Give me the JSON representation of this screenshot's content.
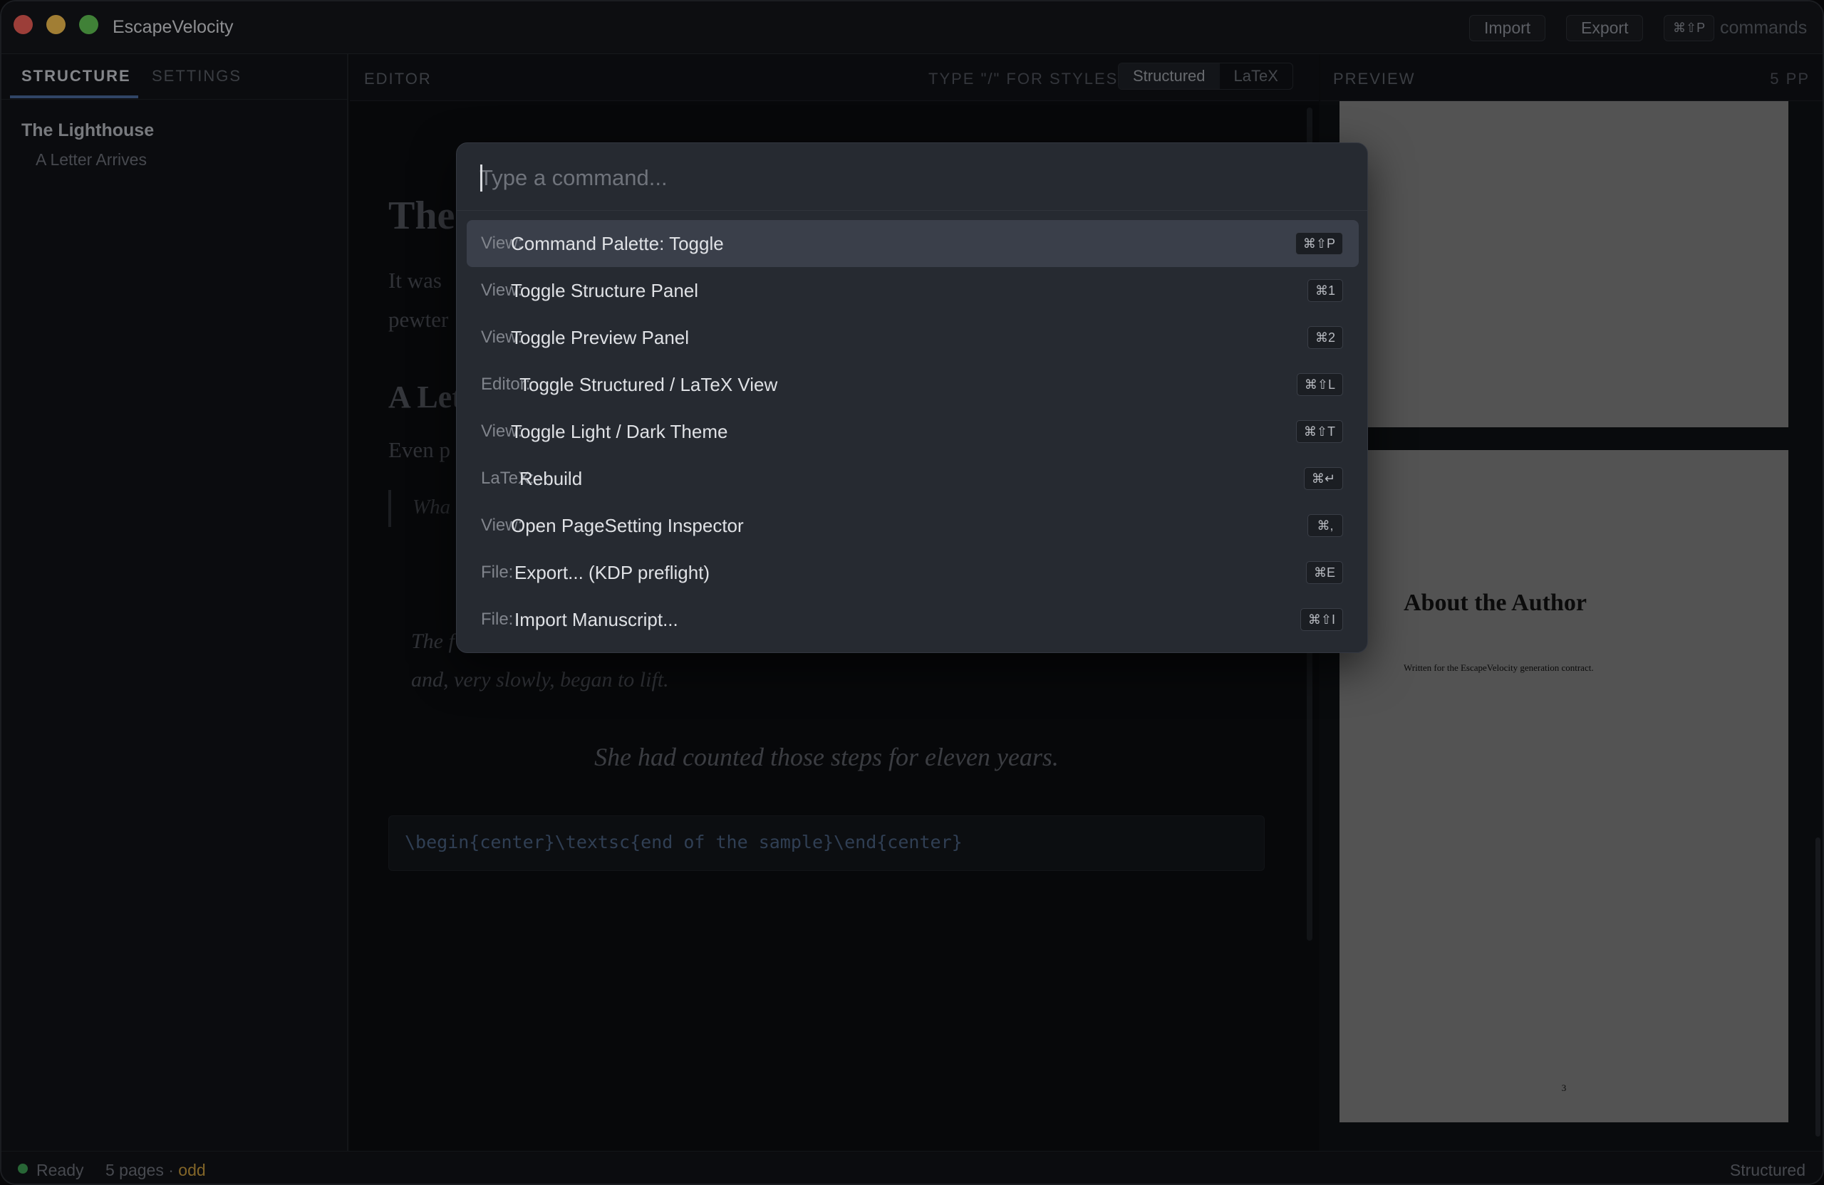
{
  "app": {
    "title": "EscapeVelocity",
    "import_label": "Import",
    "export_label": "Export",
    "palette_shortcut": "⌘⇧P",
    "commands_label": "commands"
  },
  "sidebar": {
    "tabs": [
      "STRUCTURE",
      "SETTINGS"
    ],
    "document_title": "The Lighthouse",
    "chapter": "A Letter Arrives"
  },
  "editor": {
    "header": "EDITOR",
    "hint": "TYPE \"/\" FOR STYLES",
    "modes": [
      "Structured",
      "LaTeX"
    ],
    "chapter_title_visible": "The",
    "para1_visible": "It was",
    "para2_visible": "pewter",
    "section_visible": "A Let",
    "para3_visible": "Even p",
    "quote_visible": "Wha",
    "italic1_visible": "The f",
    "italic2": "and, very slowly, began to lift.",
    "centered": "She had counted those steps for eleven years.",
    "code": "\\begin{center}\\textsc{end of the sample}\\end{center}"
  },
  "preview": {
    "header": "PREVIEW",
    "page_count": "5 PP",
    "page_title": "About the Author",
    "page_subtitle": "Written for the EscapeVelocity generation contract.",
    "page_number": "3"
  },
  "status": {
    "ready": "Ready",
    "pages_prefix": "5 pages · ",
    "parity": "odd",
    "mode": "Structured"
  },
  "palette": {
    "placeholder": "Type a command...",
    "items": [
      {
        "category": "View:",
        "label": "Command Palette: Toggle",
        "shortcut": "⌘⇧P"
      },
      {
        "category": "View:",
        "label": "Toggle Structure Panel",
        "shortcut": "⌘1"
      },
      {
        "category": "View:",
        "label": "Toggle Preview Panel",
        "shortcut": "⌘2"
      },
      {
        "category": "Editor:",
        "label": "Toggle Structured / LaTeX View",
        "shortcut": "⌘⇧L"
      },
      {
        "category": "View:",
        "label": "Toggle Light / Dark Theme",
        "shortcut": "⌘⇧T"
      },
      {
        "category": "LaTeX:",
        "label": "Rebuild",
        "shortcut": "⌘↵"
      },
      {
        "category": "View:",
        "label": "Open PageSetting Inspector",
        "shortcut": "⌘,"
      },
      {
        "category": "File:",
        "label": "Export... (KDP preflight)",
        "shortcut": "⌘E"
      },
      {
        "category": "File:",
        "label": "Import Manuscript...",
        "shortcut": "⌘⇧I"
      }
    ]
  },
  "colors": {
    "accent": "#4a6a9b",
    "status_ready": "#3e9b52",
    "parity": "#c69a3e",
    "palette_bg": "#262a31",
    "palette_selected": "#3a3f4a"
  }
}
